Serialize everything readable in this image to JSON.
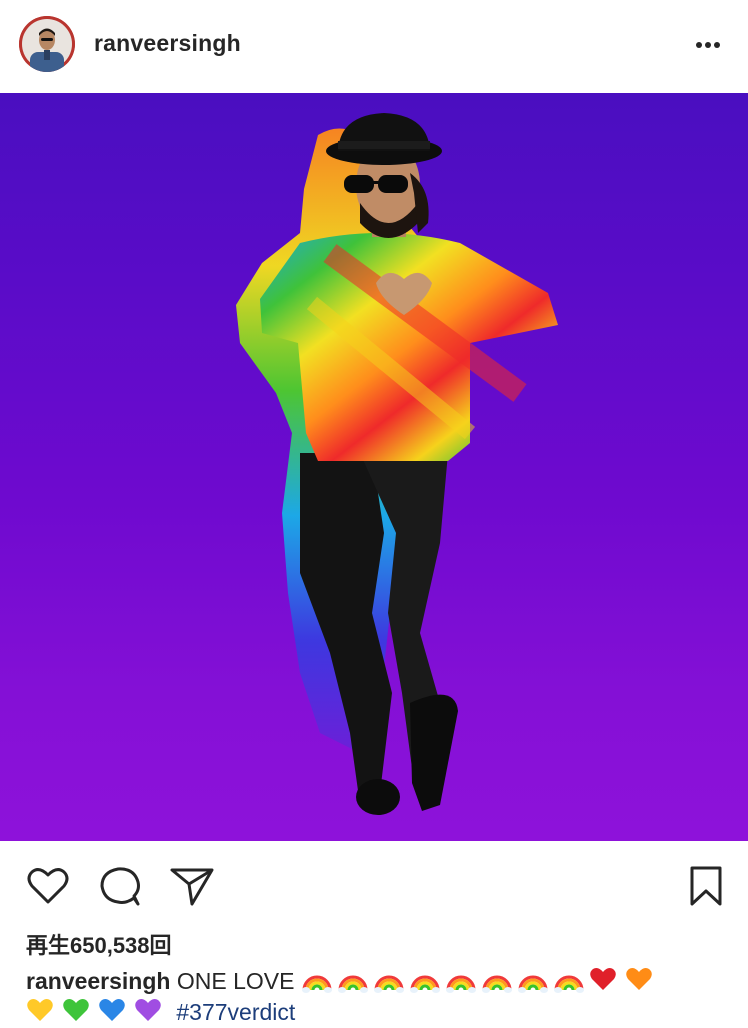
{
  "post": {
    "username": "ranveersingh",
    "more_icon": "more-horizontal-icon",
    "views_label": "再生650,538回",
    "caption": {
      "username": "ranveersingh",
      "text": "ONE LOVE",
      "emojis_line1": [
        "rainbow",
        "rainbow",
        "rainbow",
        "rainbow",
        "rainbow",
        "rainbow",
        "rainbow",
        "rainbow",
        "red-heart",
        "orange-heart"
      ],
      "emojis_line2": [
        "yellow-heart",
        "green-heart",
        "blue-heart",
        "purple-heart"
      ],
      "hashtag": "#377verdict"
    }
  },
  "actions": {
    "like_icon": "heart-outline-icon",
    "comment_icon": "comment-bubble-icon",
    "share_icon": "paper-plane-icon",
    "save_icon": "bookmark-icon"
  },
  "colors": {
    "media_top": "#4a0ec0",
    "media_bottom": "#8e12da",
    "text": "#262626",
    "hashtag": "#1c3d7a"
  }
}
